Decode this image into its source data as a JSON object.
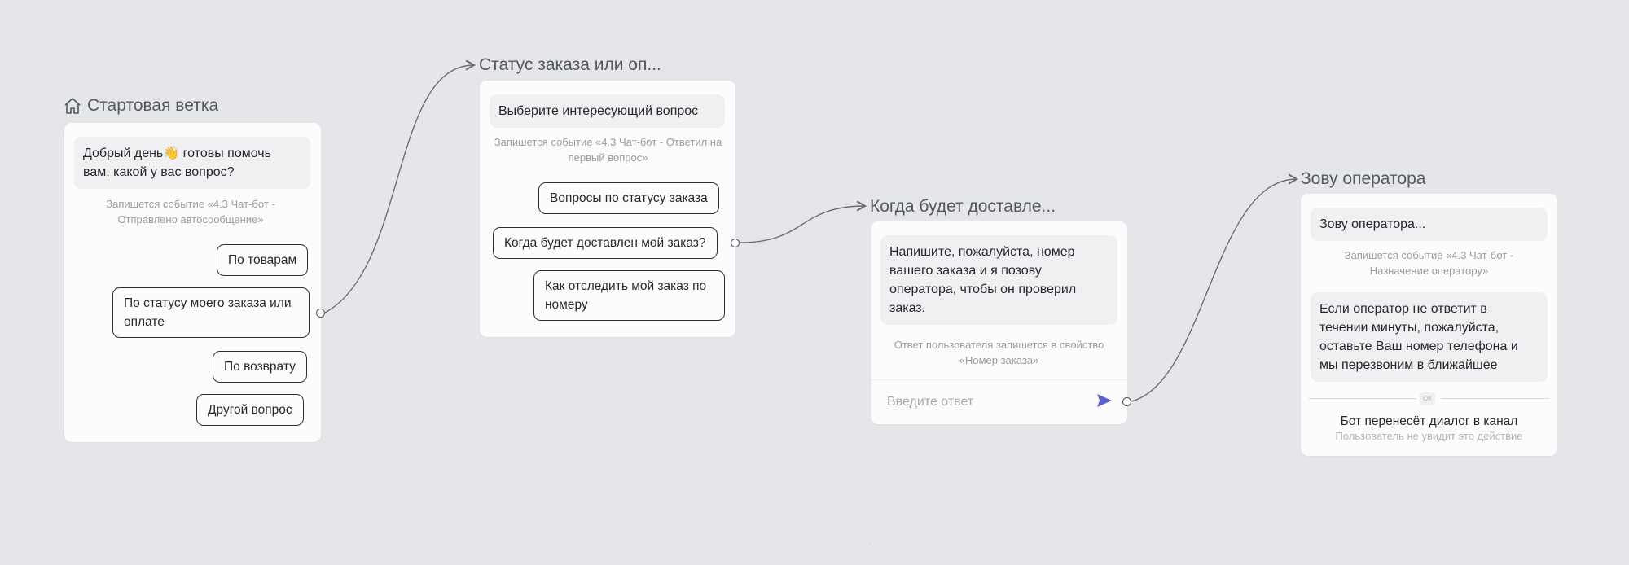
{
  "nodes": {
    "start": {
      "title": "Стартовая ветка",
      "message": "Добрый день👋 готовы помочь вам, какой у вас вопрос?",
      "event": "Запишется событие «4.3 Чат-бот - Отправлено автосообщение»",
      "buttons": [
        "По товарам",
        "По статусу моего заказа или оплате",
        "По возврату",
        "Другой вопрос"
      ]
    },
    "status": {
      "title": "Статус заказа или оп...",
      "message": "Выберите интересующий вопрос",
      "event": "Запишется событие «4.3 Чат-бот - Ответил на первый вопрос»",
      "buttons": [
        "Вопросы по статусу заказа",
        "Когда будет доставлен мой заказ?",
        "Как отследить мой заказ по номеру"
      ]
    },
    "delivery": {
      "title": "Когда будет доставле...",
      "message": "Напишите, пожалуйста, номер вашего заказа и я позову оператора, чтобы он проверил заказ.",
      "note": "Ответ пользователя запишется в свойство «Номер заказа»",
      "input_placeholder": "Введите ответ"
    },
    "operator": {
      "title": "Зову оператора",
      "message1": "Зову оператора...",
      "event": "Запишется событие «4.3 Чат-бот - Назначение оператору»",
      "message2": "Если оператор не ответит в течении минуты, пожалуйста, оставьте Ваш номер телефона и мы перезвоним в ближайшее",
      "ok_badge": "ОК",
      "transfer_title": "Бот перенесёт диалог в канал",
      "transfer_note": "Пользователь не увидит это действие"
    }
  },
  "footer_dots": "· ·",
  "colors": {
    "background": "#e5e6ea",
    "card": "#fcfcfd",
    "send_icon": "#5a5fd1",
    "connector": "#6b6d73"
  },
  "icons": {
    "home": "home-icon",
    "send": "send-icon",
    "arrow": "arrow-icon"
  }
}
